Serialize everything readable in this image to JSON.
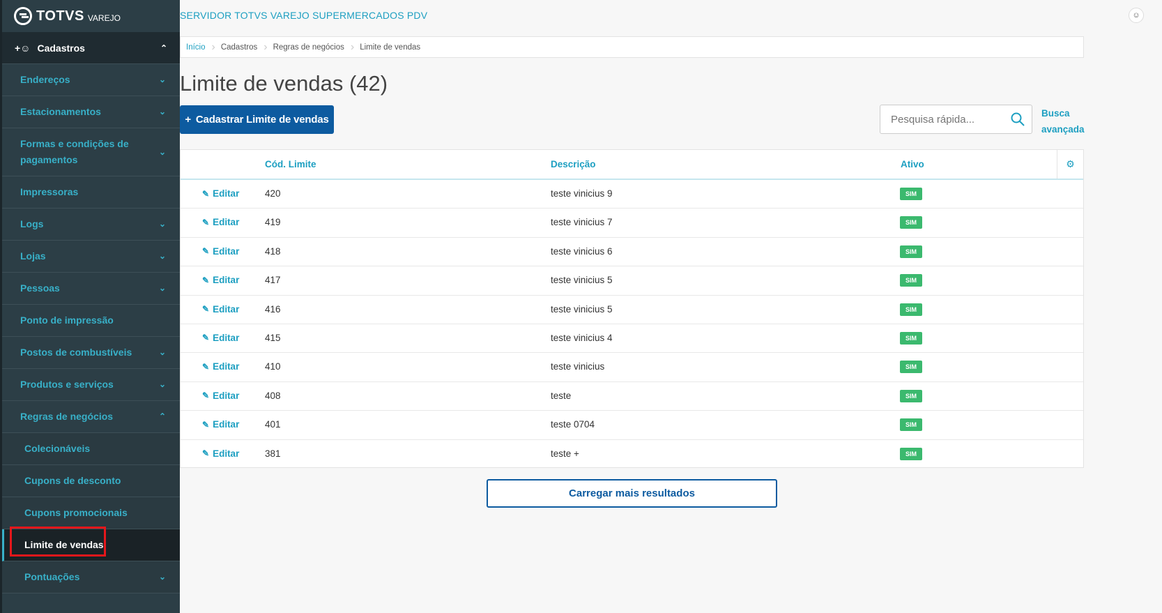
{
  "logo": {
    "text": "TOTVS",
    "sub": "VAREJO"
  },
  "server_title": "SERVIDOR TOTVS VAREJO SUPERMERCADOS PDV",
  "sidebar": {
    "group": "Cadastros",
    "items": [
      {
        "label": "Endereços",
        "chevron": "⌄"
      },
      {
        "label": "Estacionamentos",
        "chevron": "⌄"
      },
      {
        "label": "Formas e condições de pagamentos",
        "chevron": "⌄"
      },
      {
        "label": "Impressoras",
        "chevron": ""
      },
      {
        "label": "Logs",
        "chevron": "⌄"
      },
      {
        "label": "Lojas",
        "chevron": "⌄"
      },
      {
        "label": "Pessoas",
        "chevron": "⌄"
      },
      {
        "label": "Ponto de impressão",
        "chevron": ""
      },
      {
        "label": "Postos de combustíveis",
        "chevron": "⌄"
      },
      {
        "label": "Produtos e serviços",
        "chevron": "⌄"
      },
      {
        "label": "Regras de negócios",
        "chevron": "⌃"
      }
    ],
    "subitems": [
      {
        "label": "Colecionáveis"
      },
      {
        "label": "Cupons de desconto"
      },
      {
        "label": "Cupons promocionais"
      },
      {
        "label": "Limite de vendas"
      }
    ],
    "next_item": {
      "label": "Pontuações",
      "chevron": "⌄"
    }
  },
  "breadcrumb": [
    "Início",
    "Cadastros",
    "Regras de negócios",
    "Limite de vendas"
  ],
  "page_title": "Limite de vendas (42)",
  "create_button": "Cadastrar Limite de vendas",
  "search": {
    "placeholder": "Pesquisa rápida..."
  },
  "advanced_search": [
    "Busca",
    "avançada"
  ],
  "table": {
    "columns": [
      "Cód. Limite",
      "Descrição",
      "Ativo"
    ],
    "edit_label": "Editar",
    "rows": [
      {
        "cod": "420",
        "desc": "teste vinicius 9",
        "ativo": "SIM"
      },
      {
        "cod": "419",
        "desc": "teste vinicius 7",
        "ativo": "SIM"
      },
      {
        "cod": "418",
        "desc": "teste vinicius 6",
        "ativo": "SIM"
      },
      {
        "cod": "417",
        "desc": "teste vinicius 5",
        "ativo": "SIM"
      },
      {
        "cod": "416",
        "desc": "teste vinicius 5",
        "ativo": "SIM"
      },
      {
        "cod": "415",
        "desc": "teste vinicius 4",
        "ativo": "SIM"
      },
      {
        "cod": "410",
        "desc": "teste vinicius",
        "ativo": "SIM"
      },
      {
        "cod": "408",
        "desc": "teste",
        "ativo": "SIM"
      },
      {
        "cod": "401",
        "desc": "teste 0704",
        "ativo": "SIM"
      },
      {
        "cod": "381",
        "desc": "teste +",
        "ativo": "SIM"
      }
    ]
  },
  "load_more": "Carregar mais resultados",
  "colors": {
    "accent": "#1d9fc1",
    "primary": "#0d5ba0",
    "sidebar": "#2c3e46",
    "badge": "#3bb96e",
    "highlight": "#e5171b"
  }
}
